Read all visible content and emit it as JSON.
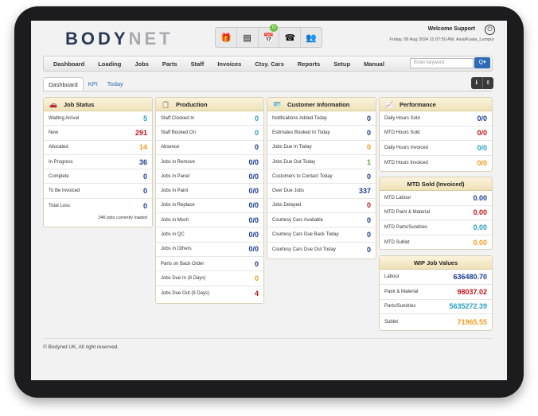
{
  "header": {
    "logo_main": "BODY",
    "logo_accent": "NET",
    "welcome": "Welcome Support",
    "datetime": "Friday, 09 Aug 2024 11:07:50 AM, Asia/Kuala_Lumpur",
    "notification_count": "0",
    "toolbar_icons": [
      "gift-icon",
      "window-icon",
      "calendar-icon",
      "phone-icon",
      "users-icon"
    ]
  },
  "nav": {
    "items": [
      "Dashboard",
      "Loading",
      "Jobs",
      "Parts",
      "Staff",
      "Invoices",
      "Ctsy. Cars",
      "Reports",
      "Setup",
      "Manual"
    ],
    "search_placeholder": "Enter keyword",
    "search_button": "Q▾"
  },
  "tabs": [
    "Dashboard",
    "KPI",
    "Today"
  ],
  "job_status": {
    "title": "Job Status",
    "rows": [
      {
        "label": "Waiting Arrival",
        "value": "5",
        "color": "#2a9fc3"
      },
      {
        "label": "New",
        "value": "291",
        "color": "#c0141b"
      },
      {
        "label": "Allocated",
        "value": "14",
        "color": "#f39a1e"
      },
      {
        "label": "In Progress",
        "value": "36",
        "color": "#1a3d8f"
      },
      {
        "label": "Complete",
        "value": "0",
        "color": "#1a3d8f"
      },
      {
        "label": "To Be Invoiced",
        "value": "0",
        "color": "#1a3d8f"
      },
      {
        "label": "Total Loss",
        "value": "0",
        "color": "#1a3d8f"
      }
    ],
    "footer": "346 jobs currently loaded"
  },
  "production": {
    "title": "Production",
    "rows": [
      {
        "label": "Staff Clocked In",
        "value": "0",
        "color": "#2a9fc3"
      },
      {
        "label": "Staff Booked On",
        "value": "0",
        "color": "#2a9fc3"
      },
      {
        "label": "Absence",
        "value": "0",
        "color": "#1a3d8f"
      },
      {
        "label": "Jobs in Remove",
        "value": "0/0",
        "color": "#1a3d8f"
      },
      {
        "label": "Jobs in Panel",
        "value": "0/0",
        "color": "#1a3d8f"
      },
      {
        "label": "Jobs in Paint",
        "value": "0/0",
        "color": "#1a3d8f"
      },
      {
        "label": "Jobs in Replace",
        "value": "0/0",
        "color": "#1a3d8f"
      },
      {
        "label": "Jobs in Mech",
        "value": "0/0",
        "color": "#1a3d8f"
      },
      {
        "label": "Jobs in QC",
        "value": "0/0",
        "color": "#1a3d8f"
      },
      {
        "label": "Jobs in Others",
        "value": "0/0",
        "color": "#1a3d8f"
      },
      {
        "label": "Parts on Back Order",
        "value": "0",
        "color": "#1a3d8f"
      },
      {
        "label": "Jobs Due In (8 Days)",
        "value": "0",
        "color": "#f39a1e"
      },
      {
        "label": "Jobs Due Out (8 Days)",
        "value": "4",
        "color": "#c0141b"
      }
    ]
  },
  "customer": {
    "title": "Customer Information",
    "rows": [
      {
        "label": "Notifications Added Today",
        "value": "0",
        "color": "#1a3d8f"
      },
      {
        "label": "Estimates Booked In Today",
        "value": "0",
        "color": "#1a3d8f"
      },
      {
        "label": "Jobs Due In Today",
        "value": "0",
        "color": "#f39a1e"
      },
      {
        "label": "Jobs Due Out Today",
        "value": "1",
        "color": "#59a92a"
      },
      {
        "label": "Customers to Contact Today",
        "value": "0",
        "color": "#1a3d8f"
      },
      {
        "label": "Over Due Jobs",
        "value": "337",
        "color": "#1a3d8f"
      },
      {
        "label": "Jobs Delayed",
        "value": "0",
        "color": "#c0141b"
      },
      {
        "label": "Courtesy Cars Available",
        "value": "0",
        "color": "#1a3d8f"
      },
      {
        "label": "Courtesy Cars Due Back Today",
        "value": "0",
        "color": "#1a3d8f"
      },
      {
        "label": "Courtesy Cars Due Out Today",
        "value": "0",
        "color": "#1a3d8f"
      }
    ]
  },
  "performance": {
    "title": "Performance",
    "rows": [
      {
        "label": "Daily Hours Sold",
        "value": "0/0",
        "color": "#1a3d8f"
      },
      {
        "label": "MTD Hours Sold",
        "value": "0/0",
        "color": "#c0141b"
      },
      {
        "label": "Daily Hours Invoiced",
        "value": "0/0",
        "color": "#2a9fc3"
      },
      {
        "label": "MTD Hours Invoiced",
        "value": "0/0",
        "color": "#f39a1e"
      }
    ]
  },
  "mtd_sold": {
    "title": "MTD Sold (Invoiced)",
    "rows": [
      {
        "label": "MTD Labour",
        "value": "0.00",
        "color": "#1a3d8f"
      },
      {
        "label": "MTD Paint & Material",
        "value": "0.00",
        "color": "#c0141b"
      },
      {
        "label": "MTD Parts/Sundries",
        "value": "0.00",
        "color": "#2a9fc3"
      },
      {
        "label": "MTD Sublet",
        "value": "0.00",
        "color": "#f39a1e"
      }
    ]
  },
  "wip": {
    "title": "WIP Job Values",
    "rows": [
      {
        "label": "Labour",
        "value": "636480.70",
        "color": "#1a3d8f"
      },
      {
        "label": "Paint & Material",
        "value": "98037.02",
        "color": "#c0141b"
      },
      {
        "label": "Parts/Sundries",
        "value": "5635272.39",
        "color": "#2a9fc3"
      },
      {
        "label": "Sublet",
        "value": "71965.55",
        "color": "#f39a1e"
      }
    ]
  },
  "footer": {
    "copyright": "© Bodynet UK, All right reserved."
  }
}
